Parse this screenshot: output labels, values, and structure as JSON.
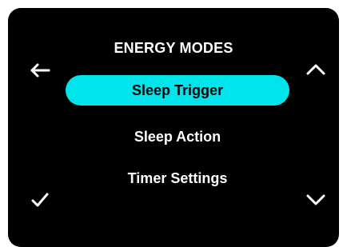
{
  "screen": {
    "title": "ENERGY MODES",
    "accent_color": "#00e5ec",
    "background_color": "#000000"
  },
  "menu": {
    "items": [
      {
        "label": "Sleep Trigger",
        "selected": true
      },
      {
        "label": "Sleep Action",
        "selected": false
      },
      {
        "label": "Timer Settings",
        "selected": false
      }
    ]
  },
  "icons": {
    "back": "arrow-left-icon",
    "up": "chevron-up-icon",
    "confirm": "checkmark-icon",
    "down": "chevron-down-icon"
  }
}
